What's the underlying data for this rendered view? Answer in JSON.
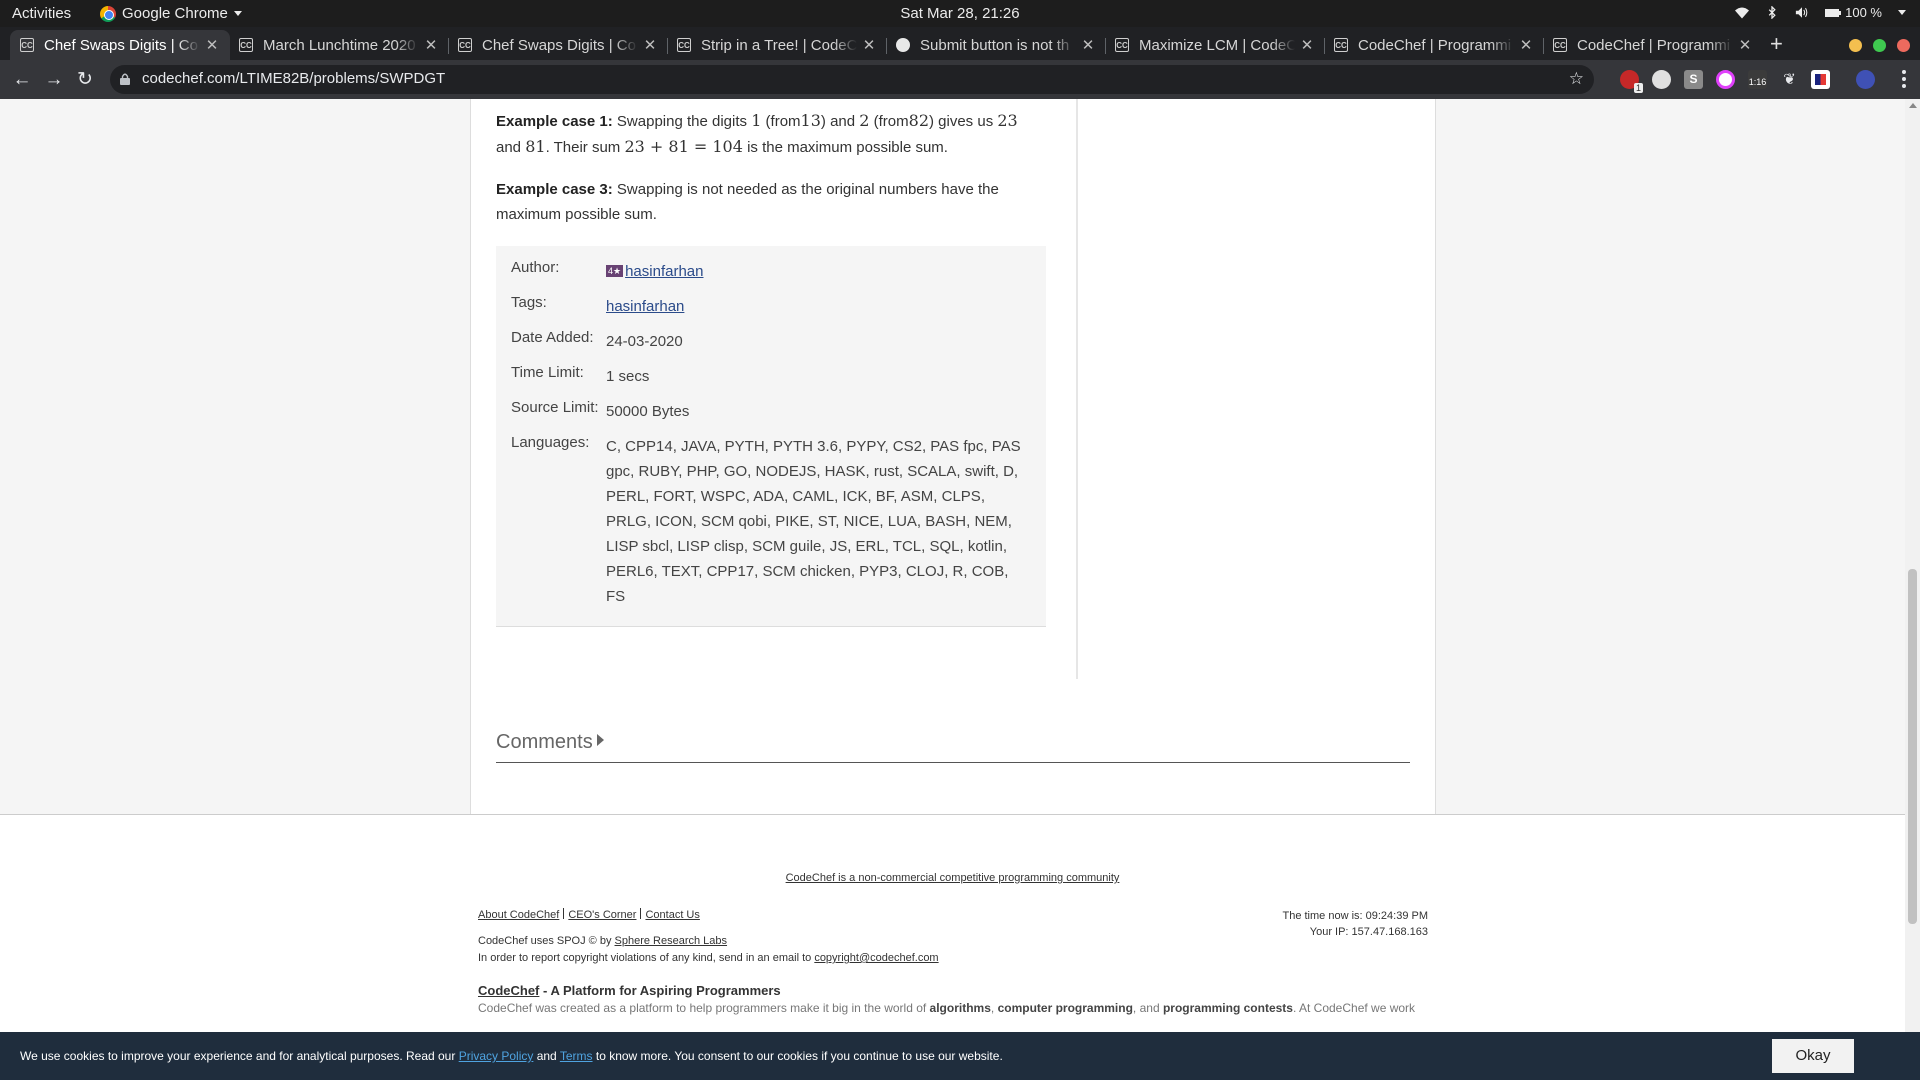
{
  "os": {
    "activities": "Activities",
    "app_name": "Google Chrome",
    "clock": "Sat Mar 28, 21:26",
    "battery": "100 %"
  },
  "tabs": [
    {
      "title": "Chef Swaps Digits | Co",
      "favicon": "CC"
    },
    {
      "title": "March Lunchtime 2020",
      "favicon": "CC"
    },
    {
      "title": "Chef Swaps Digits | Co",
      "favicon": "CC"
    },
    {
      "title": "Strip in a Tree! | CodeC",
      "favicon": "CC"
    },
    {
      "title": "Submit button is not th",
      "favicon": "doc-icon"
    },
    {
      "title": "Maximize LCM | CodeC",
      "favicon": "CC"
    },
    {
      "title": "CodeChef | Programmi",
      "favicon": "CC"
    },
    {
      "title": "CodeChef | Programmi",
      "favicon": "CC"
    }
  ],
  "address": {
    "url": "codechef.com/LTIME82B/problems/SWPDGT"
  },
  "extensions": {
    "badge": "1",
    "timer": "1:16"
  },
  "problem": {
    "example1": {
      "label": "Example case 1:",
      "t1": "Swapping the digits",
      "n1": "1",
      "t2": "(from",
      "n2": "13",
      "t3": ") and",
      "n3": "2",
      "t4": "(from",
      "n4": "82",
      "t5": ") gives us",
      "n5": "23",
      "t6": "and",
      "n6": "81",
      "t7": ". Their sum",
      "expr": "23 + 81 = 104",
      "t8": "is the maximum possible sum."
    },
    "example3": {
      "label": "Example case 3:",
      "text": "Swapping is not needed as the original numbers have the maximum possible sum."
    },
    "info": {
      "author_label": "Author:",
      "author_badge": "4★",
      "author": "hasinfarhan",
      "tags_label": "Tags:",
      "tags": "hasinfarhan",
      "date_label": "Date Added:",
      "date": "24-03-2020",
      "time_label": "Time Limit:",
      "time": "1 secs",
      "source_label": "Source Limit:",
      "source": "50000 Bytes",
      "languages_label": "Languages:",
      "languages": "C, CPP14, JAVA, PYTH, PYTH 3.6, PYPY, CS2, PAS fpc, PAS gpc, RUBY, PHP, GO, NODEJS, HASK, rust, SCALA, swift, D, PERL, FORT, WSPC, ADA, CAML, ICK, BF, ASM, CLPS, PRLG, ICON, SCM qobi, PIKE, ST, NICE, LUA, BASH, NEM, LISP sbcl, LISP clisp, SCM guile, JS, ERL, TCL, SQL, kotlin, PERL6, TEXT, CPP17, SCM chicken, PYP3, CLOJ, R, COB, FS"
    },
    "comments_label": "Comments"
  },
  "footer": {
    "tagline": "CodeChef is a non-commercial competitive programming community",
    "links": [
      "About CodeChef",
      "CEO's Corner",
      "Contact Us"
    ],
    "spoj_prefix": "CodeChef uses SPOJ © by",
    "spoj_link": "Sphere Research Labs",
    "copyright_prefix": "In order to report copyright violations of any kind, send in an email to",
    "copyright_email": "copyright@codechef.com",
    "time_now": "The time now is: 09:24:39 PM",
    "ip": "Your IP: 157.47.168.163",
    "platform_name": "CodeChef",
    "platform_suffix": " - A Platform for Aspiring Programmers",
    "about_1": "CodeChef was created as a platform to help programmers make it big in the world of ",
    "about_b1": "algorithms",
    "about_2": ", ",
    "about_b2": "computer programming",
    "about_3": ", and ",
    "about_b3": "programming contests",
    "about_4": ". At CodeChef we work"
  },
  "cookie": {
    "pre": "We use cookies to improve your experience and for analytical purposes. Read our ",
    "privacy": "Privacy Policy",
    "and": " and ",
    "terms": "Terms",
    "post": " to know more. You consent to our cookies if you continue to use our website.",
    "okay": "Okay"
  }
}
